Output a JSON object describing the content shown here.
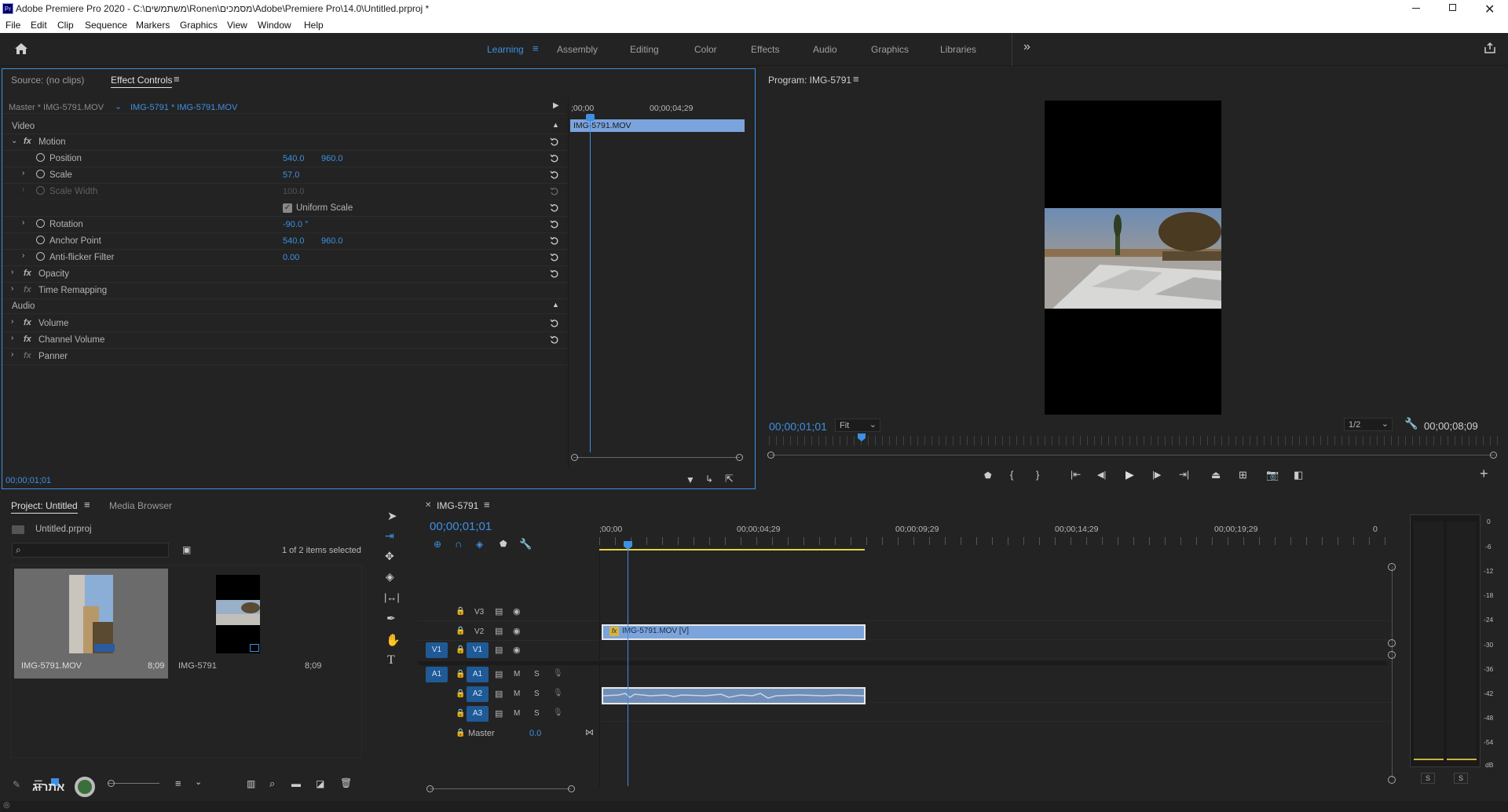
{
  "titlebar": {
    "title": "Adobe Premiere Pro 2020 - C:\\משתמשים\\Ronen\\מסמכים\\Adobe\\Premiere Pro\\14.0\\Untitled.prproj *",
    "app_badge": "Pr"
  },
  "menu": [
    "File",
    "Edit",
    "Clip",
    "Sequence",
    "Markers",
    "Graphics",
    "View",
    "Window",
    "Help"
  ],
  "workspaces": {
    "items": [
      "Learning",
      "Assembly",
      "Editing",
      "Color",
      "Effects",
      "Audio",
      "Graphics",
      "Libraries"
    ],
    "active": "Learning",
    "more": "»"
  },
  "effect_controls": {
    "source_tab": "Source: (no clips)",
    "tab": "Effect Controls",
    "master_label": "Master * IMG-5791.MOV",
    "clip_label": "IMG-5791 * IMG-5791.MOV",
    "ruler_start": ";00;00",
    "ruler_mid": "00;00;04;29",
    "clip_bar": "IMG-5791.MOV",
    "section_video": "Video",
    "motion": "Motion",
    "position": {
      "label": "Position",
      "x": "540.0",
      "y": "960.0"
    },
    "scale": {
      "label": "Scale",
      "value": "57.0"
    },
    "scale_width": {
      "label": "Scale Width",
      "value": "100.0"
    },
    "uniform_scale": "Uniform Scale",
    "rotation": {
      "label": "Rotation",
      "value": "-90.0 °"
    },
    "anchor": {
      "label": "Anchor Point",
      "x": "540.0",
      "y": "960.0"
    },
    "antiflicker": {
      "label": "Anti-flicker Filter",
      "value": "0.00"
    },
    "opacity": "Opacity",
    "time_remap": "Time Remapping",
    "section_audio": "Audio",
    "volume": "Volume",
    "channel_volume": "Channel Volume",
    "panner": "Panner",
    "timecode": "00;00;01;01"
  },
  "program": {
    "title": "Program: IMG-5791",
    "timecode": "00;00;01;01",
    "fit": "Fit",
    "resolution": "1/2",
    "duration": "00;00;08;09"
  },
  "project": {
    "tab": "Project: Untitled",
    "media_tab": "Media Browser",
    "file": "Untitled.prproj",
    "selection": "1 of 2 items selected",
    "items": [
      {
        "name": "IMG-5791.MOV",
        "duration": "8;09"
      },
      {
        "name": "IMG-5791",
        "duration": "8;09"
      }
    ],
    "bottom_logo": "אתרוג"
  },
  "timeline": {
    "tab": "IMG-5791",
    "timecode": "00;00;01;01",
    "ruler": [
      ";00;00",
      "00;00;04;29",
      "00;00;09;29",
      "00;00;14;29",
      "00;00;19;29",
      "0"
    ],
    "video_tracks": [
      "V3",
      "V2",
      "V1"
    ],
    "audio_tracks": [
      "A1",
      "A2",
      "A3"
    ],
    "src_v": "V1",
    "src_a": "A1",
    "master_label": "Master",
    "master_value": "0.0",
    "mute": "M",
    "solo": "S",
    "clip_video": "IMG-5791.MOV [V]",
    "fx_badge": "fx"
  },
  "meter": {
    "scale": [
      "0",
      "-6",
      "-12",
      "-18",
      "-24",
      "-30",
      "-36",
      "-42",
      "-48",
      "-54",
      "dB"
    ],
    "solo": [
      "S",
      "S"
    ]
  },
  "colors": {
    "accent": "#3d90e3",
    "clip_video": "#7ba3dc",
    "panel_bg": "#232323"
  }
}
